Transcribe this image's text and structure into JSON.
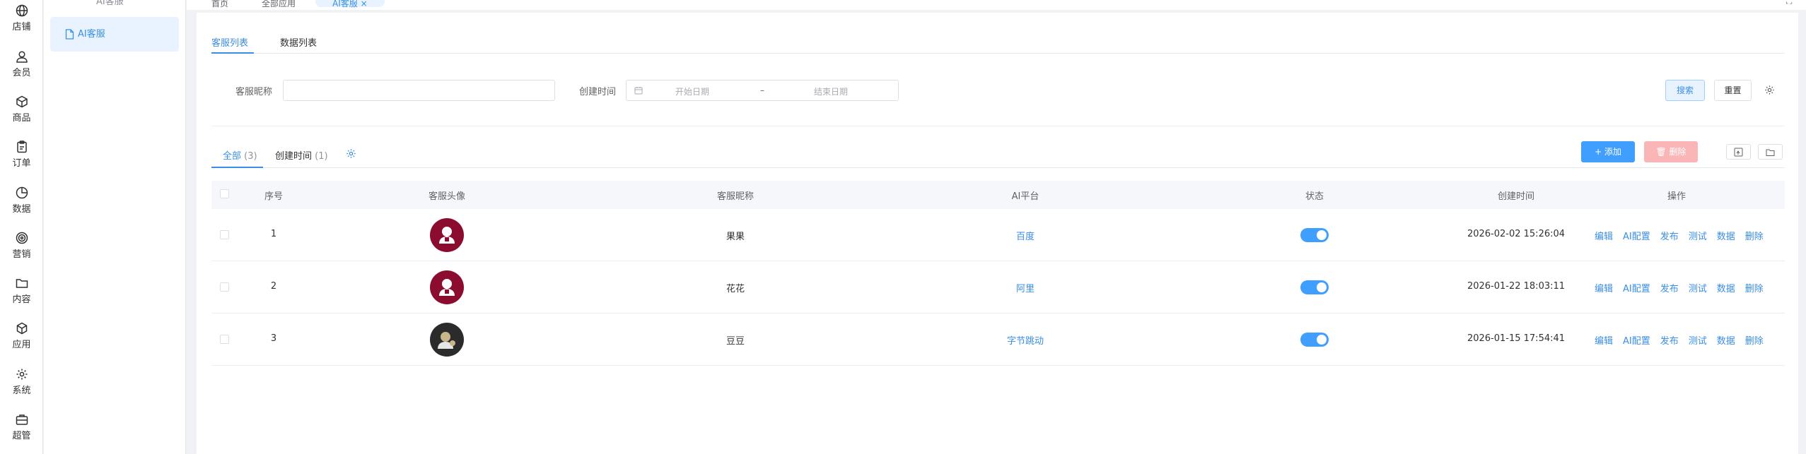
{
  "rail": {
    "items": [
      {
        "label": "店铺",
        "icon": "globe-icon"
      },
      {
        "label": "会员",
        "icon": "user-icon"
      },
      {
        "label": "商品",
        "icon": "box-icon"
      },
      {
        "label": "订单",
        "icon": "clipboard-icon"
      },
      {
        "label": "数据",
        "icon": "pie-chart-icon"
      },
      {
        "label": "营销",
        "icon": "target-icon"
      },
      {
        "label": "内容",
        "icon": "folder-icon"
      },
      {
        "label": "应用",
        "icon": "cube-icon"
      },
      {
        "label": "系统",
        "icon": "gear-icon"
      },
      {
        "label": "超管",
        "icon": "briefcase-icon"
      }
    ]
  },
  "subnav": {
    "section_title": "AI客服",
    "item": "AI客服"
  },
  "tabs": [
    "首页",
    "全部应用",
    "AI客服"
  ],
  "page_tabs": [
    "客服列表",
    "数据列表"
  ],
  "filters": {
    "nickname_label": "客服昵称",
    "created_label": "创建时间",
    "start_placeholder": "开始日期",
    "range_sep": "–",
    "end_placeholder": "结束日期",
    "search": "搜索",
    "reset": "重置"
  },
  "list_tabs": [
    {
      "label": "全部",
      "count": "(3)"
    },
    {
      "label": "创建时间",
      "count": "(1)"
    }
  ],
  "actions": {
    "add": "+ 添加",
    "delete": "删除"
  },
  "table": {
    "headers": [
      "序号",
      "客服头像",
      "客服昵称",
      "AI平台",
      "状态",
      "创建时间",
      "操作"
    ],
    "rows": [
      {
        "no": "1",
        "avatar": "avatar-red",
        "nickname": "果果",
        "platform": "百度",
        "enabled": true,
        "created": "2026-02-02 15:26:04"
      },
      {
        "no": "2",
        "avatar": "avatar-red",
        "nickname": "花花",
        "platform": "阿里",
        "enabled": true,
        "created": "2026-01-22 18:03:11"
      },
      {
        "no": "3",
        "avatar": "avatar-dark",
        "nickname": "豆豆",
        "platform": "字节跳动",
        "enabled": true,
        "created": "2026-01-15 17:54:41"
      }
    ],
    "ops": [
      "编辑",
      "AI配置",
      "发布",
      "测试",
      "数据",
      "删除"
    ]
  },
  "colors": {
    "accent": "#409eff",
    "avatar_red": "#8b0c2e",
    "avatar_dark": "#2b2b2b"
  }
}
